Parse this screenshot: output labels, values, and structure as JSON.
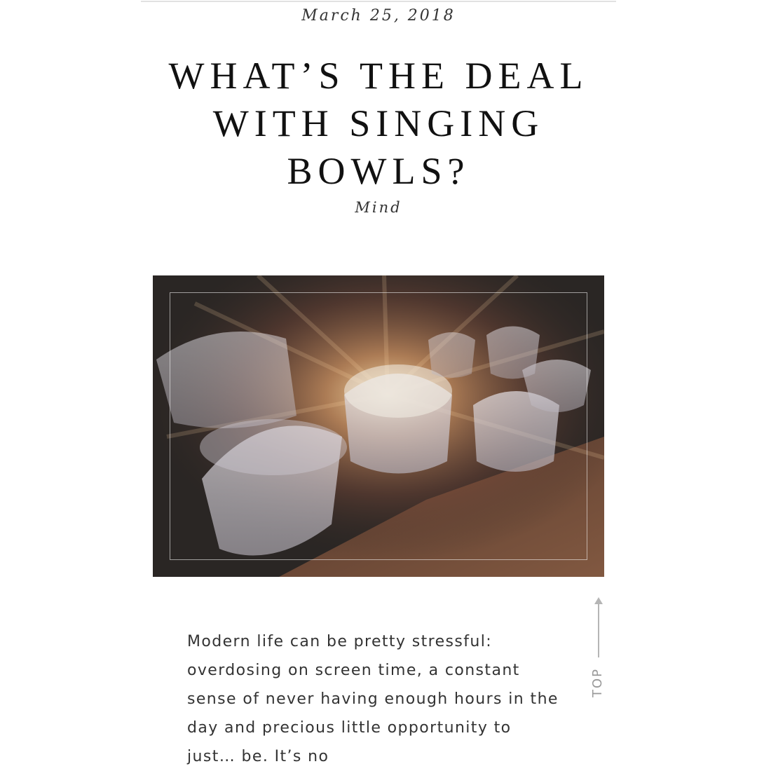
{
  "post": {
    "date": "March 25, 2018",
    "title": "WHAT’S THE DEAL WITH SINGING BOWLS?",
    "category": "Mind",
    "body_text": "Modern life can be pretty stressful: overdosing on screen time, a constant sense of never having enough hours in the day and precious little opportunity to just… be. It’s no"
  },
  "hero_image": {
    "icon": "photo-singing-bowls",
    "colors": {
      "background": "#2a2624",
      "floor": "#7a5039",
      "bowl": "#d8d4da",
      "glow": "#ffe7b0"
    }
  },
  "scroll_top": {
    "label": "TOP",
    "icon": "arrow-up-icon"
  }
}
